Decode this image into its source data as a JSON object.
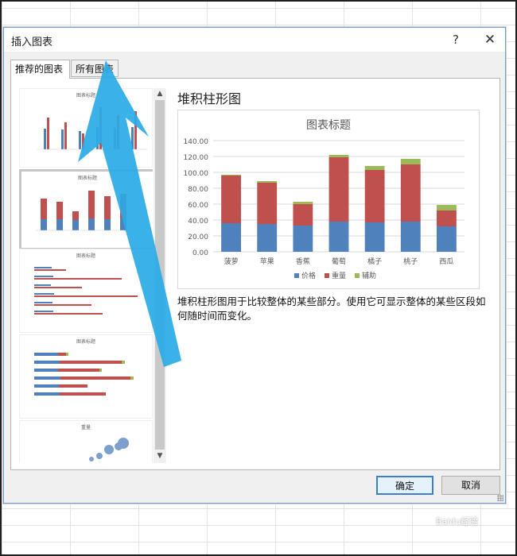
{
  "dialog": {
    "title": "插入图表",
    "help_glyph": "?",
    "close_glyph": "✕",
    "tabs": [
      "推荐的图表",
      "所有图表"
    ],
    "selected_chart_type": "堆积柱形图",
    "description": "堆积柱形图用于比较整体的某些部分。使用它可显示整体的某些区段如何随时间而变化。",
    "ok_label": "确定",
    "cancel_label": "取消"
  },
  "scrollbar": {
    "up_glyph": "▲",
    "down_glyph": "▼"
  },
  "thumbnails": [
    {
      "title": "图表标题",
      "kind": "clustered-column"
    },
    {
      "title": "图表标题",
      "kind": "stacked-column"
    },
    {
      "title": "图表标题",
      "kind": "clustered-bar"
    },
    {
      "title": "图表标题",
      "kind": "stacked-bar"
    },
    {
      "title": "重量",
      "kind": "bubble"
    }
  ],
  "watermark": "Baidu经验",
  "colors": {
    "price": "#4f81bd",
    "weight": "#c0504d",
    "aux": "#9bbb59",
    "arrow": "#2aaae8"
  },
  "chart_data": {
    "type": "bar",
    "stacked": true,
    "title": "图表标题",
    "categories": [
      "菠萝",
      "苹果",
      "香蕉",
      "葡萄",
      "橘子",
      "桃子",
      "西瓜"
    ],
    "series": [
      {
        "name": "价格",
        "values": [
          36,
          35,
          33,
          38,
          37,
          38,
          32
        ]
      },
      {
        "name": "重量",
        "values": [
          60,
          52,
          27,
          81,
          66,
          72,
          20
        ]
      },
      {
        "name": "辅助",
        "values": [
          1,
          2,
          3,
          3,
          5,
          7,
          7
        ]
      }
    ],
    "yticks": [
      "0.00",
      "20.00",
      "40.00",
      "60.00",
      "80.00",
      "100.00",
      "120.00",
      "140.00"
    ],
    "ylim": [
      0,
      140
    ],
    "legend_position": "bottom"
  }
}
